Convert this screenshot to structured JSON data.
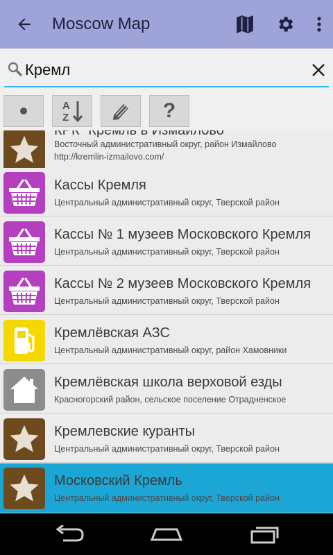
{
  "appbar": {
    "title": "Moscow Map",
    "icons": [
      "back-arrow-icon",
      "map-icon",
      "gear-icon",
      "more-vert-icon"
    ],
    "color": "#9ea4d8"
  },
  "search": {
    "value": "Кремл",
    "accent": "#33b5e5"
  },
  "toolbar": {
    "buttons": [
      {
        "name": "dot-button",
        "label": "•"
      },
      {
        "name": "sort-az-button",
        "label": "A↓Z"
      },
      {
        "name": "edit-button",
        "label": "✎"
      },
      {
        "name": "help-button",
        "label": "?"
      }
    ]
  },
  "list": {
    "items": [
      {
        "name": "КРК \"Кремль в Измайлово\"",
        "address": "Восточный административный округ, район Измайлово",
        "url": "http://kremlin-izmailovo.com/",
        "icon": "star-icon",
        "color": "#6e4b1f"
      },
      {
        "name": "Кассы Кремля",
        "address": "Центральный административный округ, Тверской район",
        "icon": "basket-icon",
        "color": "#b43fbf"
      },
      {
        "name": "Кассы № 1 музеев Московского Кремля",
        "address": "Центральный административный округ, Тверской район",
        "icon": "basket-icon",
        "color": "#b43fbf"
      },
      {
        "name": "Кассы № 2 музеев Московского Кремля",
        "address": "Центральный административный округ, Тверской район",
        "icon": "basket-icon",
        "color": "#b43fbf"
      },
      {
        "name": "Кремлёвская АЗС",
        "address": "Центральный административный округ, район Хамовники",
        "icon": "fuel-pump-icon",
        "color": "#f5d800"
      },
      {
        "name": "Кремлёвская школа верховой езды",
        "address": "Красногорский район, сельское поселение Отрадненское",
        "icon": "house-icon",
        "color": "#8c8c8c"
      },
      {
        "name": "Кремлевские куранты",
        "address": "Центральный административный округ, Тверской район",
        "icon": "star-icon",
        "color": "#6e4b1f"
      },
      {
        "name": "Московский Кремль",
        "address": "Центральный административный округ, Тверской район",
        "icon": "star-icon",
        "color": "#6e4b1f",
        "selected": true
      }
    ],
    "selected_color": "#1ba6d6"
  },
  "navbar": {
    "icons": [
      "back-nav-icon",
      "home-nav-icon",
      "recents-nav-icon"
    ]
  }
}
